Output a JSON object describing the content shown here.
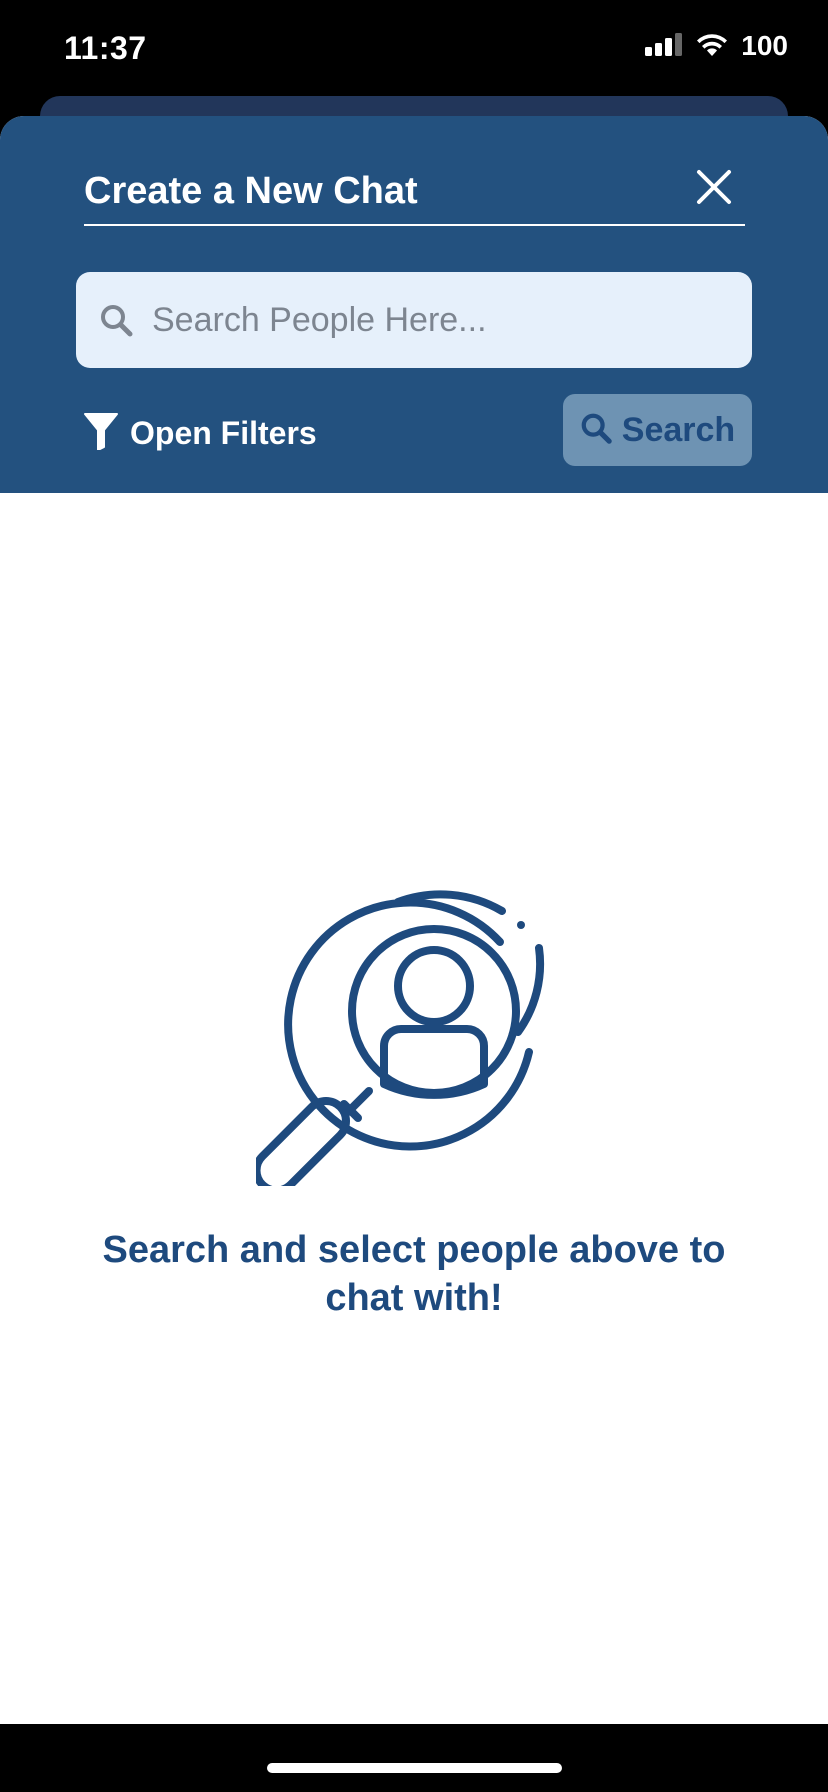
{
  "status_bar": {
    "time": "11:37",
    "battery": "100",
    "icons": [
      "signal-icon",
      "wifi-icon"
    ]
  },
  "header": {
    "title": "Create a New Chat",
    "close_icon": "close-icon",
    "search": {
      "placeholder": "Search People Here...",
      "value": "",
      "icon": "search-icon"
    },
    "filters": {
      "label": "Open Filters",
      "icon": "filter-icon"
    },
    "search_button": {
      "label": "Search",
      "icon": "search-icon"
    }
  },
  "empty_state": {
    "icon": "person-search-icon",
    "message": "Search and select people above to chat with!"
  },
  "colors": {
    "header_bg": "#23517f",
    "accent": "#1e4a7e",
    "search_bg": "#e6f0fb",
    "search_button_bg": "#6e93b3"
  }
}
